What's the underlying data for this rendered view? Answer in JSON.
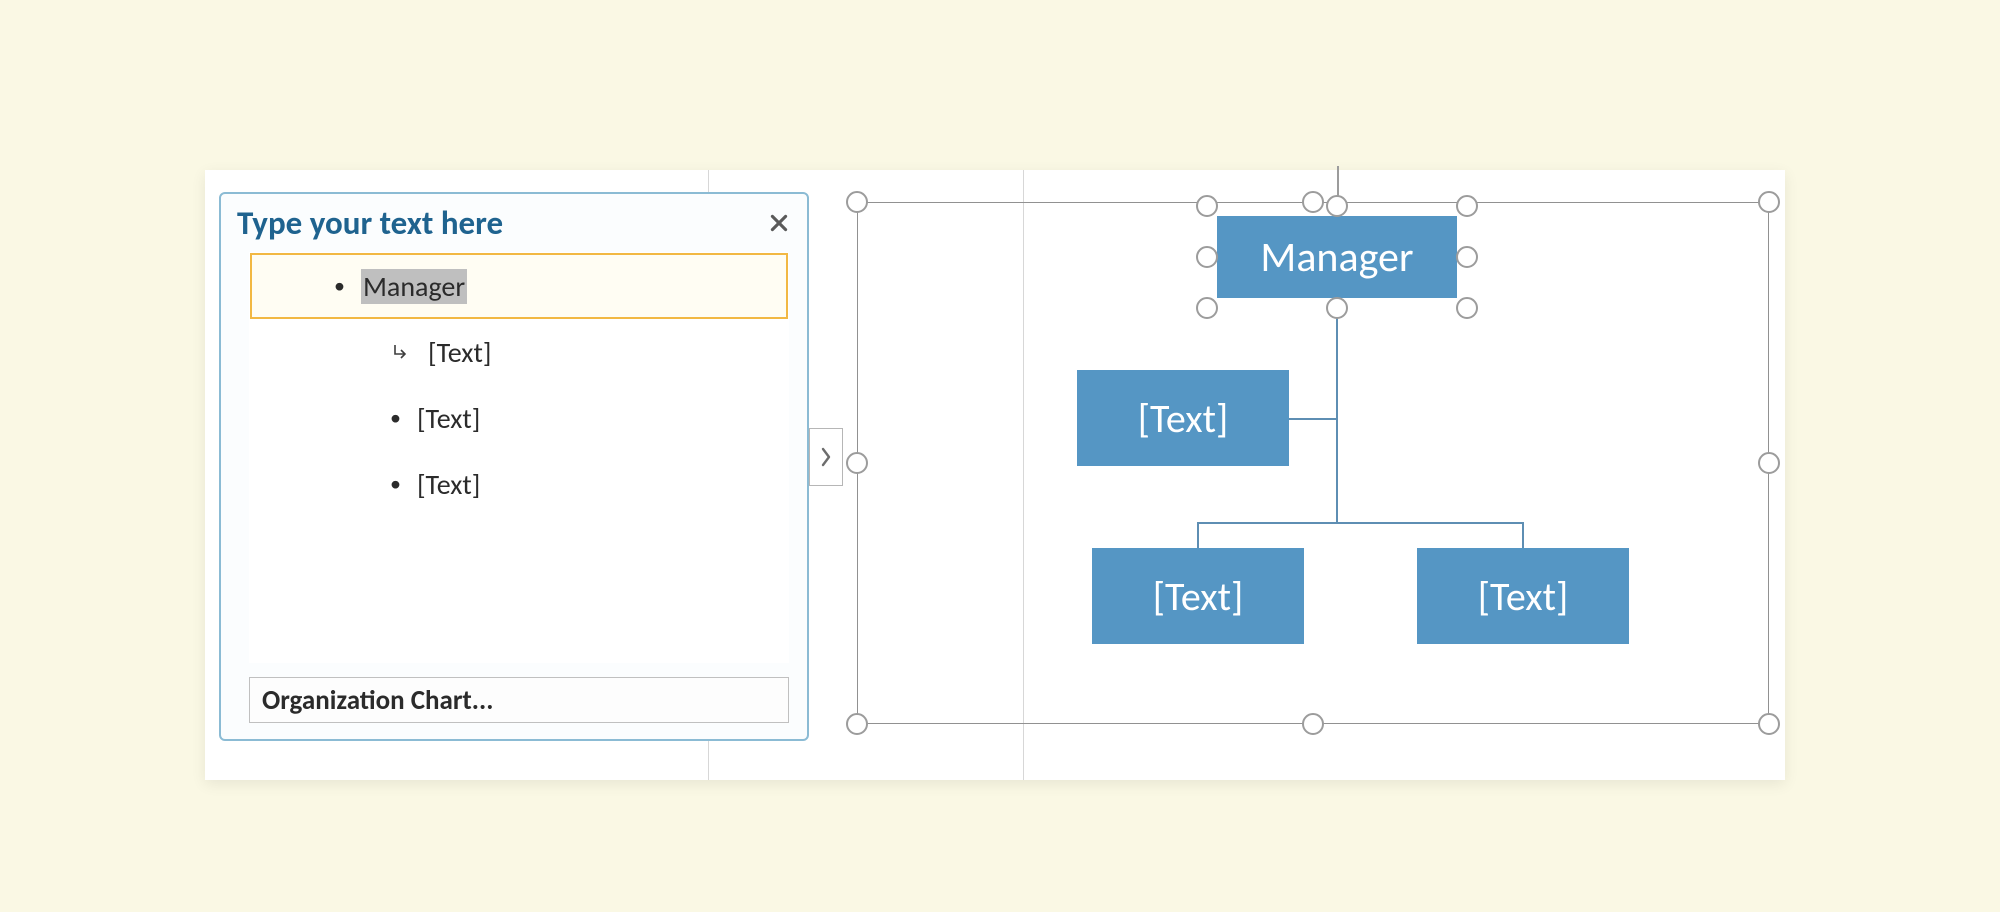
{
  "text_pane": {
    "title": "Type your text here",
    "footer": "Organization Chart...",
    "items": [
      {
        "label": "Manager",
        "level": 1,
        "bullet": "•",
        "selected": true,
        "highlighted": true
      },
      {
        "label": "[Text]",
        "level": 2,
        "bullet": "arrow"
      },
      {
        "label": "[Text]",
        "level": 2,
        "bullet": "•"
      },
      {
        "label": "[Text]",
        "level": 2,
        "bullet": "•"
      }
    ]
  },
  "chart": {
    "nodes": {
      "manager": "Manager",
      "assistant": "[Text]",
      "child_a": "[Text]",
      "child_b": "[Text]"
    }
  },
  "chart_data": {
    "type": "org-chart",
    "root": {
      "label": "Manager",
      "assistant": {
        "label": "[Text]"
      },
      "children": [
        {
          "label": "[Text]"
        },
        {
          "label": "[Text]"
        }
      ]
    }
  },
  "colors": {
    "node_fill": "#5596c4",
    "panel_accent": "#1f638f"
  }
}
